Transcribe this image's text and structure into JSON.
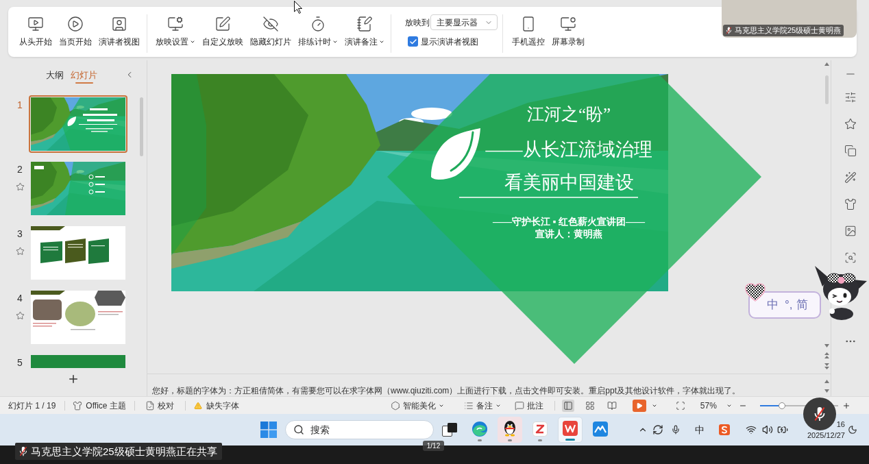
{
  "ribbon": {
    "start_buttons": [
      {
        "kind": "start-from-beginning",
        "label": "从头开始",
        "dropdown": false
      },
      {
        "kind": "start-from-current",
        "label": "当页开始",
        "dropdown": false
      },
      {
        "kind": "presenter-view",
        "label": "演讲者视图",
        "dropdown": false
      }
    ],
    "show_buttons": [
      {
        "kind": "show-settings",
        "label": "放映设置",
        "dropdown": true
      },
      {
        "kind": "custom-show",
        "label": "自定义放映",
        "dropdown": false
      },
      {
        "kind": "hide-slide",
        "label": "隐藏幻灯片",
        "dropdown": false
      },
      {
        "kind": "rehearse",
        "label": "排练计时",
        "dropdown": true
      },
      {
        "kind": "speaker-notes",
        "label": "演讲备注",
        "dropdown": true
      }
    ],
    "display_to": {
      "label": "放映到",
      "value": "主要显示器"
    },
    "presenter_view": {
      "label": "显示演讲者视图",
      "checked": true
    },
    "tool_buttons": [
      {
        "kind": "phone-remote",
        "label": "手机遥控",
        "dropdown": false
      },
      {
        "kind": "screen-record",
        "label": "屏幕录制",
        "dropdown": false
      }
    ]
  },
  "video_tile": {
    "name": "马克思主义学院25级硕士黄明燕",
    "muted": true
  },
  "left_panel": {
    "tabs": [
      {
        "label": "大纲",
        "selected": false
      },
      {
        "label": "幻灯片",
        "selected": true
      }
    ],
    "slides": [
      {
        "number": "1",
        "kind": "title",
        "selected": true,
        "starred": false
      },
      {
        "number": "2",
        "kind": "agenda",
        "selected": false,
        "starred": true
      },
      {
        "number": "3",
        "kind": "cards",
        "selected": false,
        "starred": true
      },
      {
        "number": "4",
        "kind": "photos",
        "selected": false,
        "starred": true
      },
      {
        "number": "5",
        "kind": "banner",
        "selected": false,
        "starred": false
      }
    ]
  },
  "slide": {
    "title": "江河之“盼”",
    "subtitle": [
      "——从长江流域治理",
      "看美丽中国建设"
    ],
    "team": "——守护长江 ▪ 红色薪火宣讲团——",
    "speaker": "宣讲人：黄明燕"
  },
  "notes": "您好，标题的字体为：方正粗倩简体，有需要您可以在求字体网（www.qiuziti.com）上面进行下载，点击文件即可安装。重启ppt及其他设计软件，字体就出现了。",
  "ime_widget": {
    "mode": "中",
    "punctuation": "°,",
    "script": "简"
  },
  "status_bar": {
    "slide_counter": "幻灯片 1 / 19",
    "theme": "Office 主题",
    "proofing": "校对",
    "missing_fonts": "缺失字体",
    "beautify": "智能美化",
    "notes": "备注",
    "comments": "批注",
    "views": [
      {
        "kind": "normal",
        "selected": true
      },
      {
        "kind": "sorter",
        "selected": false
      },
      {
        "kind": "reading",
        "selected": false
      }
    ],
    "zoom": "57%",
    "zoom_slider": {
      "level": 0.28
    }
  },
  "mic_button": {
    "muted": true
  },
  "taskbar": {
    "search": {
      "placeholder": "搜索"
    },
    "apps": [
      {
        "kind": "task-view",
        "running": false,
        "focused": false,
        "flashing": false
      },
      {
        "kind": "browser",
        "running": true,
        "focused": false,
        "flashing": false
      },
      {
        "kind": "penguin",
        "running": true,
        "focused": false,
        "flashing": true
      },
      {
        "kind": "z-app",
        "running": true,
        "focused": false,
        "flashing": false
      },
      {
        "kind": "office",
        "running": true,
        "focused": true,
        "flashing": false
      },
      {
        "kind": "mountain",
        "running": false,
        "focused": false,
        "flashing": false
      }
    ],
    "tray": {
      "ime": "中",
      "time": "16",
      "date": "2025/12/27"
    }
  },
  "share_banner": {
    "text": "马克思主义学院25级硕士黄明燕正在共享",
    "muted": true,
    "page": "1/12"
  }
}
